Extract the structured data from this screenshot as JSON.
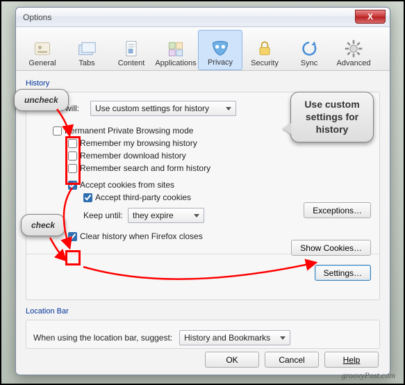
{
  "window": {
    "title": "Options",
    "close_glyph": "X"
  },
  "tabs": [
    {
      "id": "general",
      "label": "General"
    },
    {
      "id": "tabs",
      "label": "Tabs"
    },
    {
      "id": "content",
      "label": "Content"
    },
    {
      "id": "applications",
      "label": "Applications"
    },
    {
      "id": "privacy",
      "label": "Privacy",
      "selected": true
    },
    {
      "id": "security",
      "label": "Security"
    },
    {
      "id": "sync",
      "label": "Sync"
    },
    {
      "id": "advanced",
      "label": "Advanced"
    }
  ],
  "history": {
    "group_label": "History",
    "will_label": "Firefox will:",
    "will_value": "Use custom settings for history",
    "ppb": {
      "label": "Permanent Private Browsing mode",
      "checked": false
    },
    "remember_browsing": {
      "label": "Remember my browsing history",
      "checked": false
    },
    "remember_download": {
      "label": "Remember download history",
      "checked": false
    },
    "remember_forms": {
      "label": "Remember search and form history",
      "checked": false
    },
    "accept_cookies": {
      "label": "Accept cookies from sites",
      "checked": true
    },
    "accept_third": {
      "label": "Accept third-party cookies",
      "checked": true
    },
    "keep_until_label": "Keep until:",
    "keep_until_value": "they expire",
    "clear_on_close": {
      "label": "Clear history when Firefox closes",
      "checked": true
    },
    "buttons": {
      "exceptions": "Exceptions…",
      "show_cookies": "Show Cookies…",
      "settings": "Settings…"
    }
  },
  "location_bar": {
    "group_label": "Location Bar",
    "suggest_label": "When using the location bar, suggest:",
    "suggest_value": "History and Bookmarks"
  },
  "footer": {
    "ok": "OK",
    "cancel": "Cancel",
    "help": "Help"
  },
  "annotations": {
    "uncheck": "uncheck",
    "check": "check",
    "use_custom": "Use custom settings for history"
  },
  "watermark": "groovyPost.com"
}
